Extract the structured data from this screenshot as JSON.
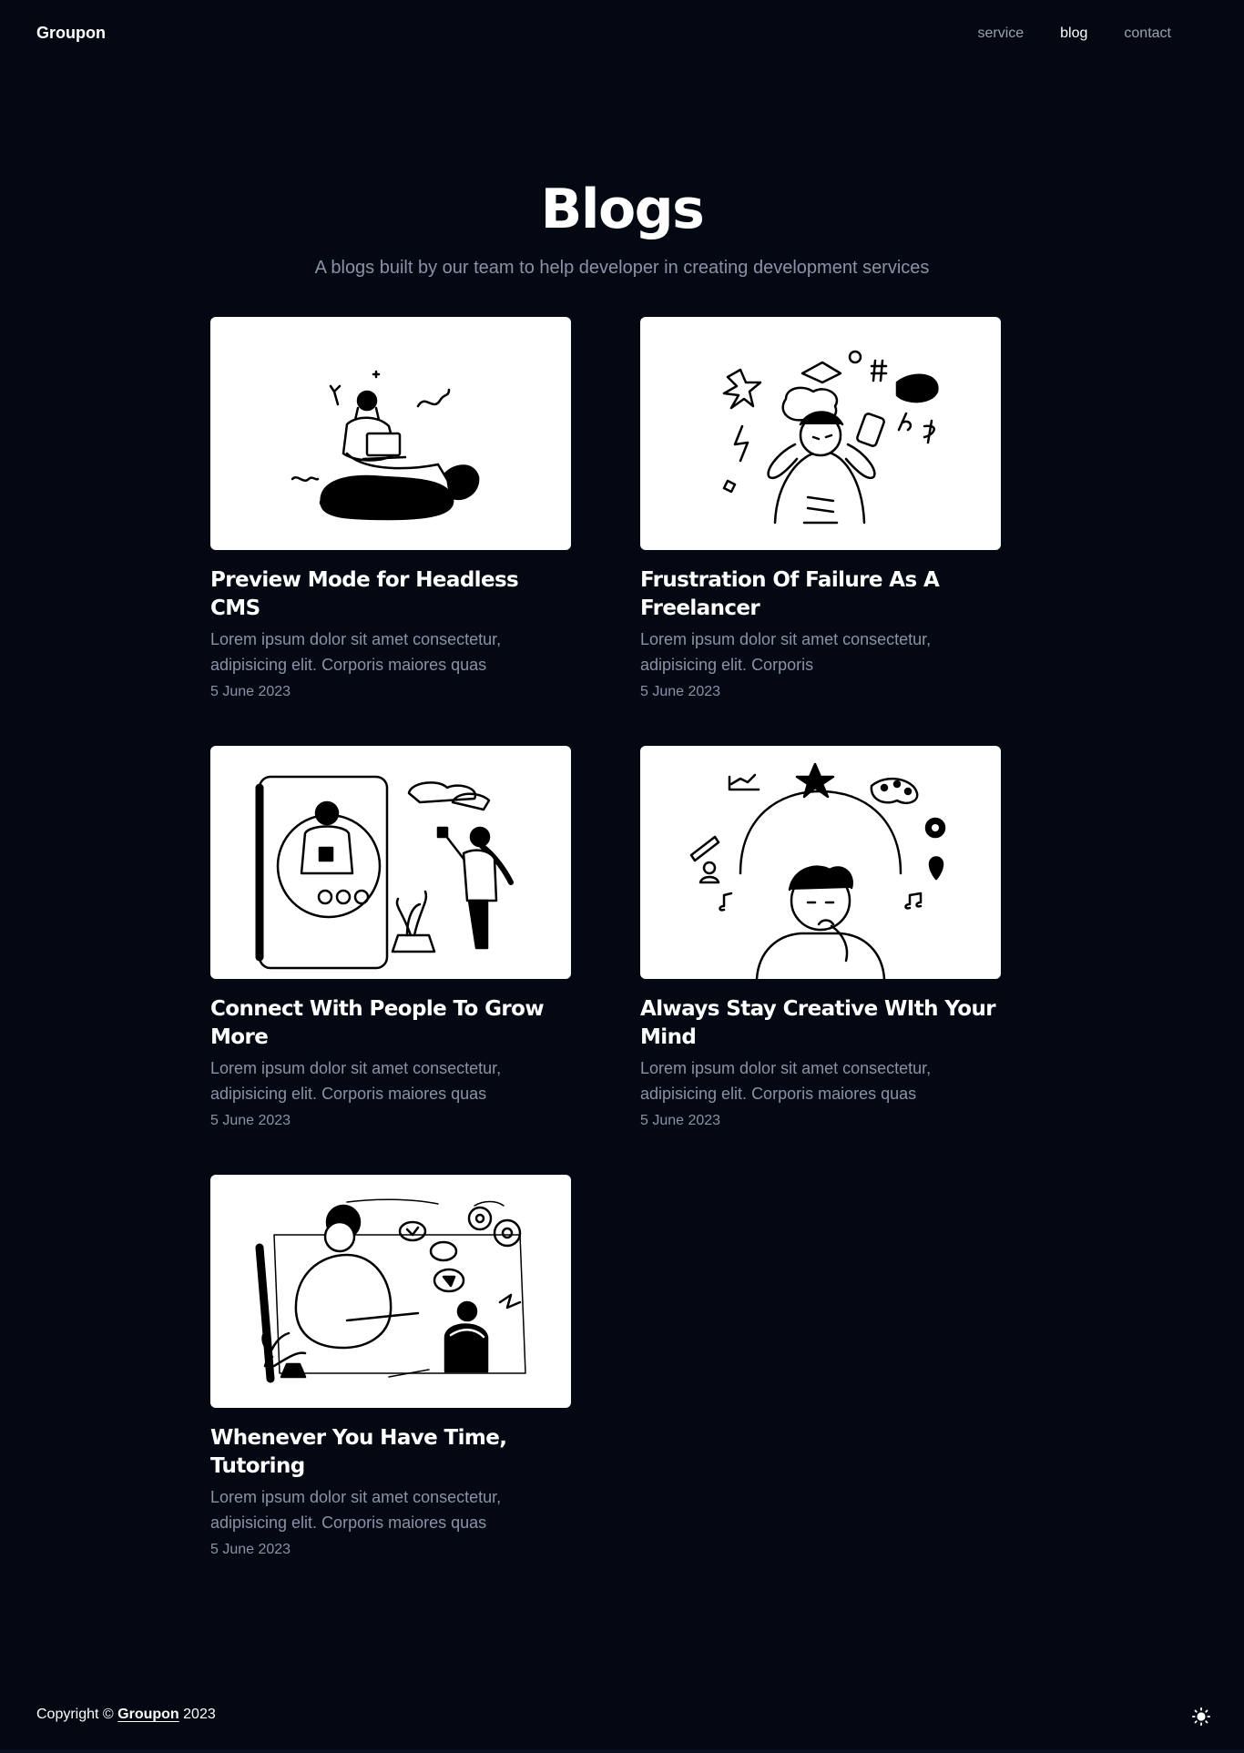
{
  "header": {
    "logo": "Groupon",
    "nav": [
      {
        "label": "service",
        "active": false
      },
      {
        "label": "blog",
        "active": true
      },
      {
        "label": "contact",
        "active": false
      }
    ]
  },
  "hero": {
    "title": "Blogs",
    "subtitle": "A blogs built by our team to help developer in creating development services"
  },
  "posts": [
    {
      "title": "Preview Mode for Headless CMS",
      "excerpt": "Lorem ipsum dolor sit amet consectetur, adipisicing elit. Corporis maiores quas",
      "date": "5 June 2023",
      "image": "woman-with-laptop-illustration"
    },
    {
      "title": "Frustration Of Failure As A Freelancer",
      "excerpt": "Lorem ipsum dolor sit amet consectetur, adipisicing elit. Corporis",
      "date": "5 June 2023",
      "image": "frustrated-man-illustration"
    },
    {
      "title": "Connect With People To Grow More",
      "excerpt": "Lorem ipsum dolor sit amet consectetur, adipisicing elit. Corporis maiores quas",
      "date": "5 June 2023",
      "image": "video-call-illustration"
    },
    {
      "title": "Always Stay Creative WIth Your Mind",
      "excerpt": "Lorem ipsum dolor sit amet consectetur, adipisicing elit. Corporis maiores quas",
      "date": "5 June 2023",
      "image": "thinking-man-illustration"
    },
    {
      "title": "Whenever You Have Time, Tutoring",
      "excerpt": "Lorem ipsum dolor sit amet consectetur, adipisicing elit. Corporis maiores quas",
      "date": "5 June 2023",
      "image": "online-tutoring-illustration"
    }
  ],
  "footer": {
    "prefix": "Copyright © ",
    "brand": "Groupon",
    "year": " 2023",
    "theme_icon": "sun-icon"
  },
  "colors": {
    "background": "#040812",
    "muted_text": "#8a92a6",
    "card_image_bg": "#ffffff"
  }
}
